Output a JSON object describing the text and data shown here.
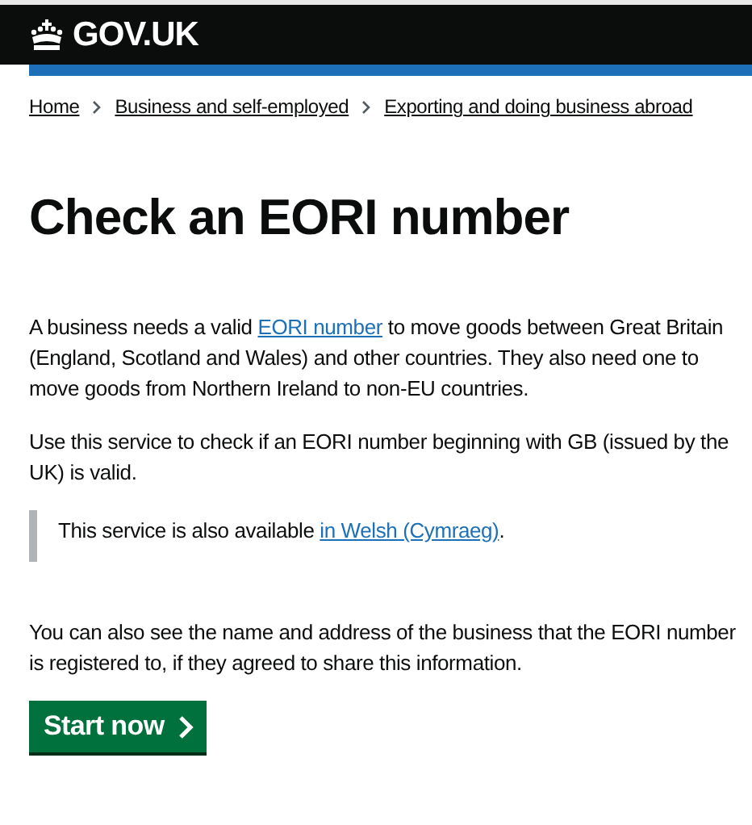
{
  "header": {
    "logo": "GOV.UK"
  },
  "breadcrumbs": [
    {
      "label": "Home"
    },
    {
      "label": "Business and self-employed"
    },
    {
      "label": "Exporting and doing business abroad"
    }
  ],
  "title": "Check an EORI number",
  "intro": {
    "before": "A business needs a valid ",
    "link": "EORI number",
    "after": " to move goods between Great Britain (England, Scotland and Wales) and other countries. They also need one to move goods from Northern Ireland to non-EU countries."
  },
  "usage": "Use this service to check if an EORI number beginning with GB (issued by the UK) is valid.",
  "inset": {
    "before": "This service is also available ",
    "link": "in Welsh (Cymraeg)",
    "after": "."
  },
  "details": "You can also see the name and address of the business that the EORI number is registered to, if they agreed to share this information.",
  "button": {
    "label": "Start now"
  }
}
